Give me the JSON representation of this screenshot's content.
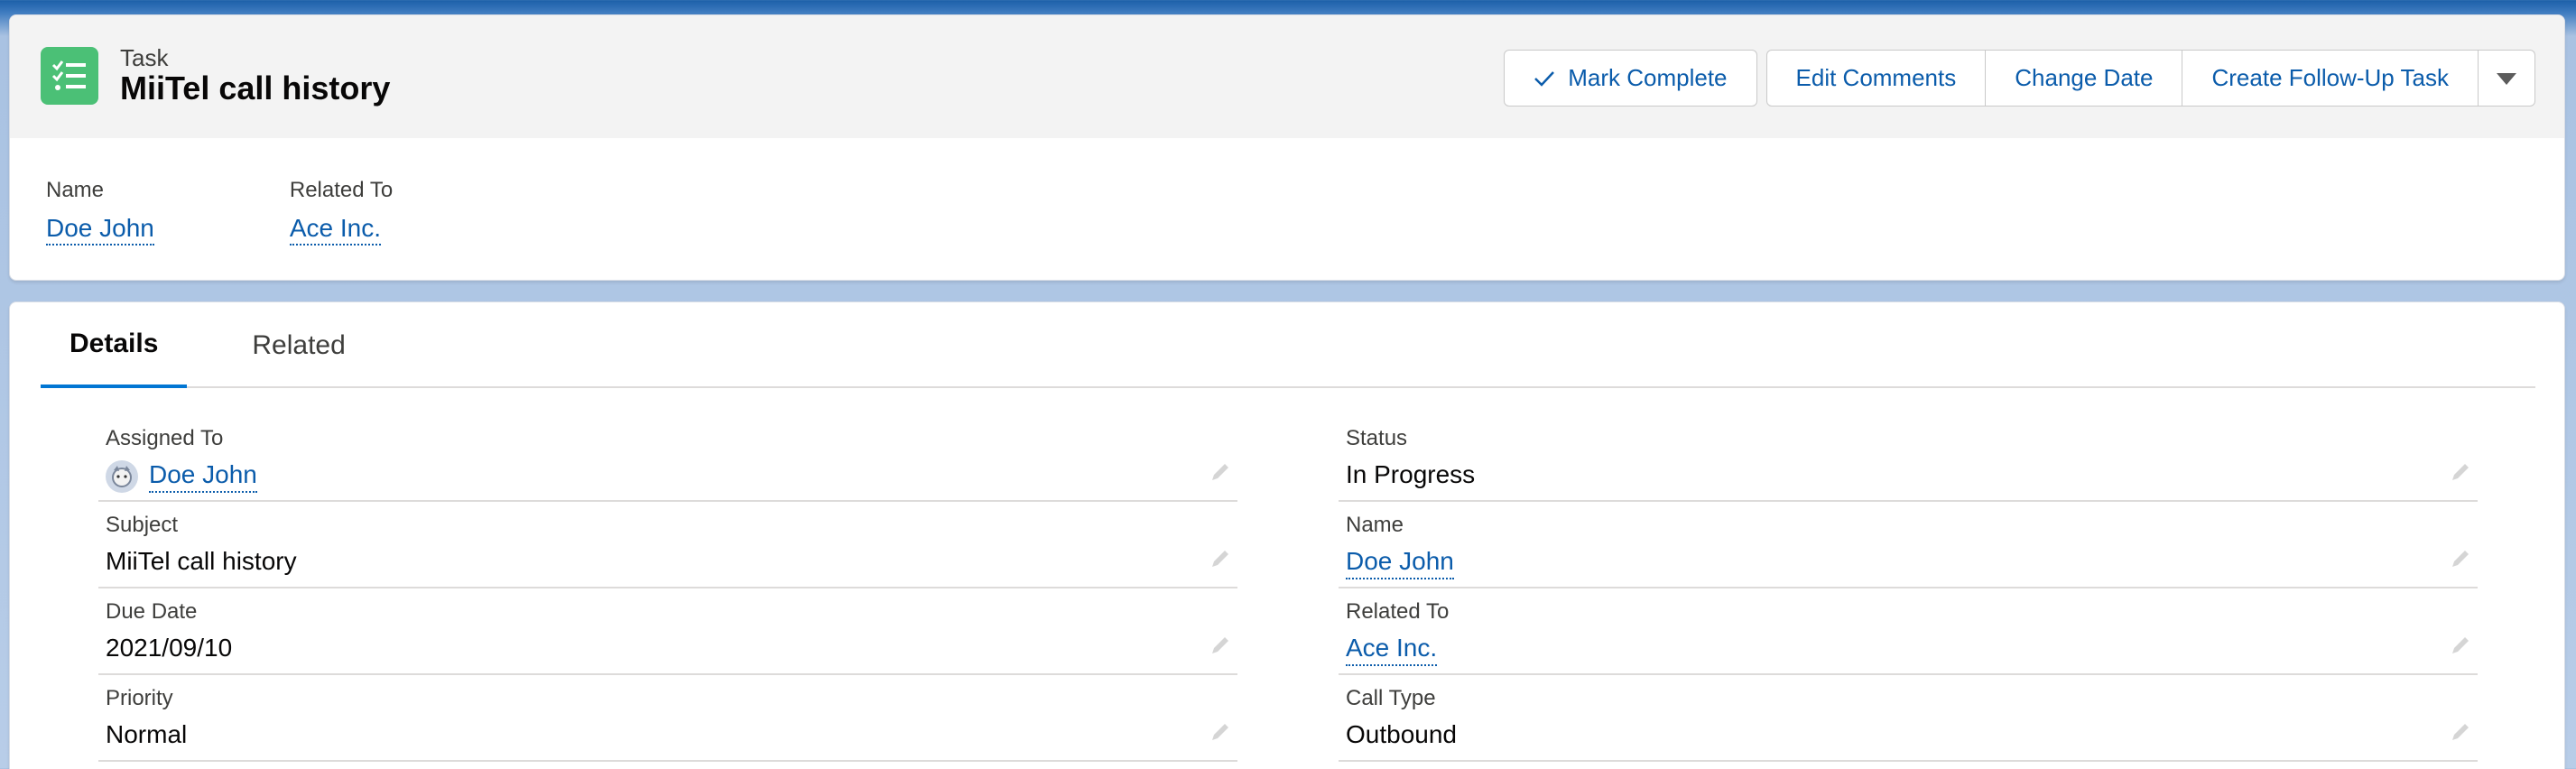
{
  "header": {
    "object_label": "Task",
    "title": "MiiTel call history",
    "icon": "task-checklist-icon",
    "actions": {
      "mark_complete": "Mark Complete",
      "edit_comments": "Edit Comments",
      "change_date": "Change Date",
      "create_follow_up": "Create Follow-Up Task"
    }
  },
  "highlights": {
    "name_label": "Name",
    "name_value": "Doe John",
    "related_label": "Related To",
    "related_value": "Ace Inc."
  },
  "tabs": {
    "details": "Details",
    "related": "Related"
  },
  "fields": {
    "assigned_to": {
      "label": "Assigned To",
      "value": "Doe John"
    },
    "subject": {
      "label": "Subject",
      "value": "MiiTel call history"
    },
    "due_date": {
      "label": "Due Date",
      "value": "2021/09/10"
    },
    "priority": {
      "label": "Priority",
      "value": "Normal"
    },
    "status": {
      "label": "Status",
      "value": "In Progress"
    },
    "name": {
      "label": "Name",
      "value": "Doe John"
    },
    "related_to": {
      "label": "Related To",
      "value": "Ace Inc."
    },
    "call_type": {
      "label": "Call Type",
      "value": "Outbound"
    }
  },
  "colors": {
    "brand_link": "#0b5cab",
    "task_icon_bg": "#4bc076",
    "active_tab": "#0176d3"
  }
}
